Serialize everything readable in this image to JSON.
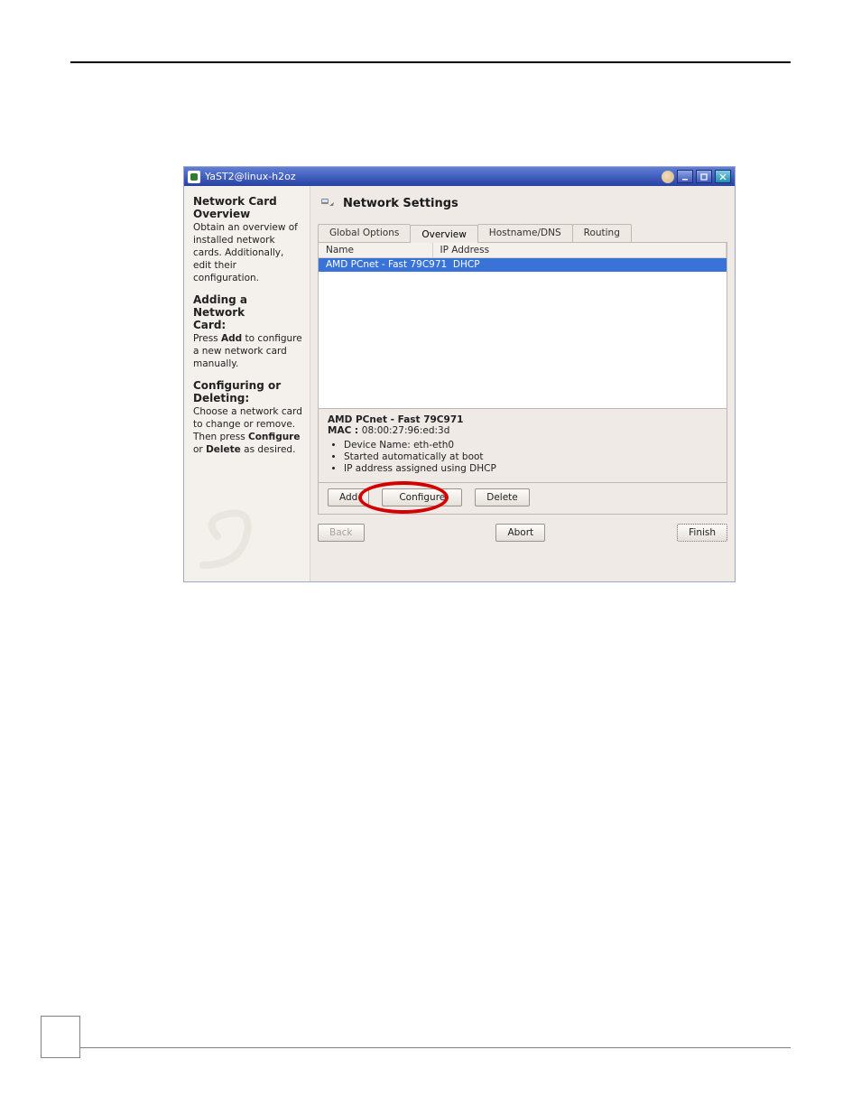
{
  "titlebar": {
    "title": "YaST2@linux-h2oz"
  },
  "sidebar": {
    "heading1_a": "Network Card",
    "heading1_b": "Overview",
    "para1": "Obtain an overview of installed network cards. Additionally, edit their configuration.",
    "heading2_a": "Adding a Network",
    "heading2_b": "Card:",
    "para2_pre": "Press ",
    "para2_bold": "Add",
    "para2_post": " to configure a new network card manually.",
    "heading3_a": "Configuring or",
    "heading3_b": "Deleting:",
    "para3_pre": "Choose a network card to change or remove. Then press ",
    "para3_bold1": "Configure",
    "para3_mid": " or ",
    "para3_bold2": "Delete",
    "para3_post": " as desired."
  },
  "main": {
    "heading": "Network Settings",
    "tabs": {
      "global": "Global Options",
      "overview": "Overview",
      "hostname": "Hostname/DNS",
      "routing": "Routing"
    },
    "table": {
      "col_name": "Name",
      "col_ip": "IP Address",
      "row_name": "AMD PCnet - Fast 79C971",
      "row_ip": "DHCP"
    },
    "details": {
      "title": "AMD PCnet - Fast 79C971",
      "mac_label": "MAC : ",
      "mac_value": "08:00:27:96:ed:3d",
      "b1": "Device Name: eth-eth0",
      "b2": "Started automatically at boot",
      "b3": "IP address assigned using DHCP"
    },
    "actions": {
      "add": "Add",
      "configure": "Configure",
      "delete": "Delete"
    },
    "wizard": {
      "back": "Back",
      "abort": "Abort",
      "finish": "Finish"
    }
  }
}
